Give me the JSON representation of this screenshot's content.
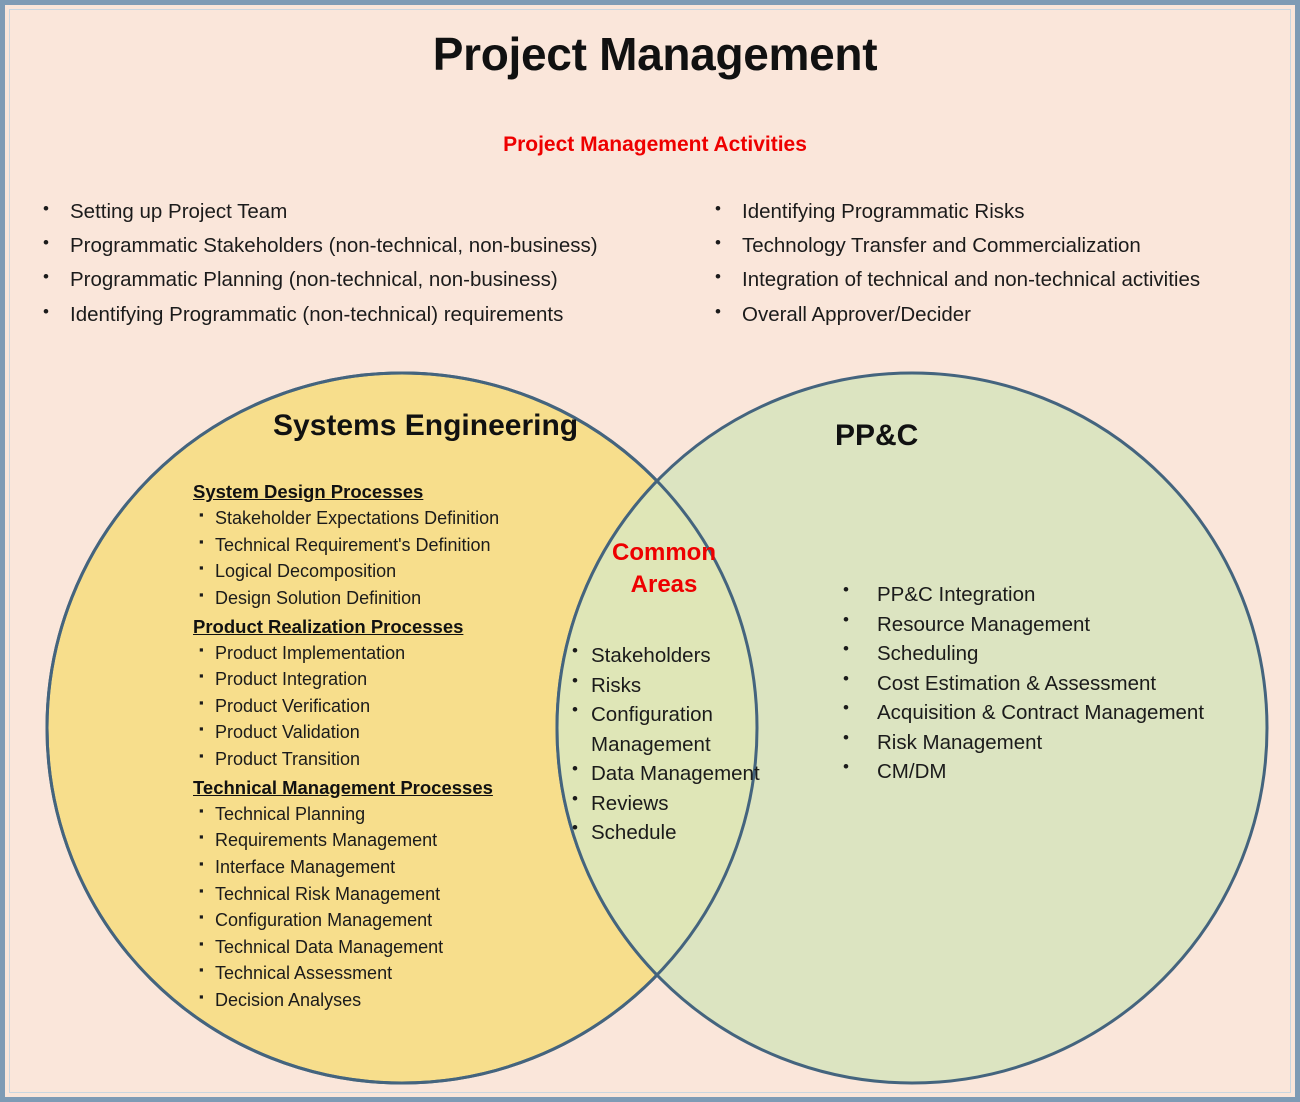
{
  "page": {
    "title": "Project Management",
    "subtitle": "Project Management Activities"
  },
  "colors": {
    "background": "#FAE6DA",
    "frame_border": "#7E9BB5",
    "circle_stroke": "#44647E",
    "systems_engineering_fill": "#F7DE8C",
    "ppc_fill": "#D9E3BE",
    "overlap_fill": "#DEE5B4",
    "accent_red": "#EE0000",
    "text": "#1B1B1B"
  },
  "activities": {
    "left_column": [
      "Setting up Project Team",
      "Programmatic Stakeholders (non-technical, non-business)",
      "Programmatic Planning (non-technical, non-business)",
      "Identifying Programmatic (non-technical) requirements"
    ],
    "right_column": [
      "Identifying Programmatic Risks",
      "Technology Transfer and Commercialization",
      "Integration of technical and non-technical activities",
      "Overall Approver/Decider"
    ]
  },
  "venn": {
    "left_circle": {
      "heading": "Systems Engineering",
      "groups": [
        {
          "title": "System Design Processes",
          "items": [
            "Stakeholder Expectations Definition",
            "Technical Requirement's Definition",
            "Logical Decomposition",
            "Design Solution Definition"
          ]
        },
        {
          "title": "Product Realization Processes",
          "items": [
            "Product Implementation",
            "Product Integration",
            "Product Verification",
            "Product Validation",
            "Product Transition"
          ]
        },
        {
          "title": "Technical Management Processes",
          "items": [
            "Technical Planning",
            "Requirements Management",
            "Interface Management",
            "Technical Risk Management",
            "Configuration Management",
            "Technical Data Management",
            "Technical Assessment",
            "Decision Analyses"
          ]
        }
      ]
    },
    "overlap": {
      "heading": "Common Areas",
      "items": [
        "Stakeholders",
        "Risks",
        "Configuration Management",
        "Data Management",
        "Reviews",
        "Schedule"
      ]
    },
    "right_circle": {
      "heading": "PP&C",
      "items": [
        "PP&C Integration",
        "Resource Management",
        "Scheduling",
        "Cost Estimation & Assessment",
        "Acquisition & Contract Management",
        "Risk Management",
        "CM/DM"
      ]
    }
  }
}
